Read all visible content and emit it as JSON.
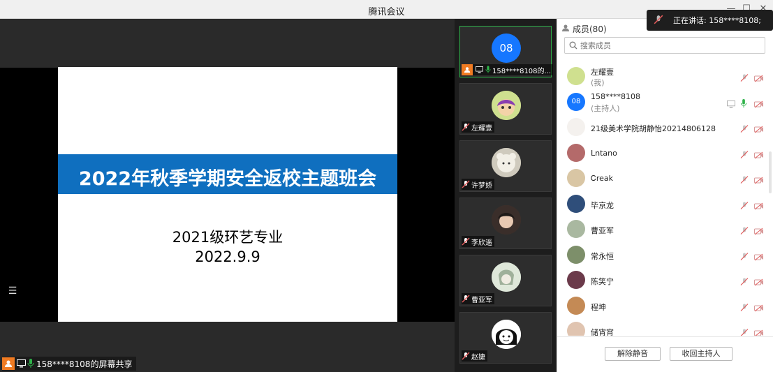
{
  "window": {
    "title": "腾讯会议",
    "min": "—",
    "max": "☐",
    "close": "✕"
  },
  "speaking": {
    "text": "正在讲话: 158****8108;"
  },
  "slide": {
    "title": "2022年秋季学期安全返校主题班会",
    "line1": "2021级环艺专业",
    "line2": "2022.9.9"
  },
  "share_label": "158****8108的屏幕共享",
  "videos": [
    {
      "name": "158****8108的...",
      "avatar_text": "08",
      "active": true
    },
    {
      "name": "左耀壹"
    },
    {
      "name": "许梦娇"
    },
    {
      "name": "李欣遥"
    },
    {
      "name": "曹亚军"
    },
    {
      "name": "赵婕"
    }
  ],
  "panel": {
    "title": "成员(80)",
    "search_placeholder": "搜索成员",
    "members": [
      {
        "name": "左耀壹",
        "sub": "(我)"
      },
      {
        "name": "158****8108",
        "sub": "(主持人)",
        "avatar_text": "08"
      },
      {
        "name": "21级美术学院胡静怡20214806128"
      },
      {
        "name": "Lntano"
      },
      {
        "name": "Ꮯreak"
      },
      {
        "name": "毕京龙"
      },
      {
        "name": "曹亚军"
      },
      {
        "name": "常永恒"
      },
      {
        "name": "陈笑宁"
      },
      {
        "name": "程坤"
      },
      {
        "name": "储宵宵"
      }
    ],
    "btn_unmute": "解除静音",
    "btn_reclaim": "收回主持人"
  },
  "colors": {
    "accent": "#0f6fbf",
    "host_orange": "#f07b22",
    "blue_avatar": "#1677ff",
    "mic_green": "#2fb34a",
    "muted_red": "#e05a5a"
  }
}
